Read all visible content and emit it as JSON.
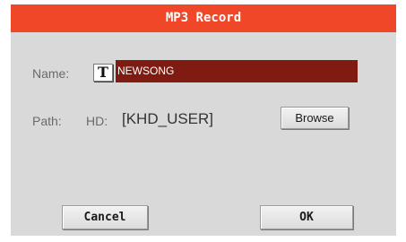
{
  "dialog": {
    "title": "MP3 Record",
    "title_color": "#ef4728",
    "background_color": "#d9d9d9"
  },
  "name_row": {
    "label": "Name:",
    "text_edit_icon": "T",
    "value": "NEWSONG",
    "field_color": "#7f1b10"
  },
  "path_row": {
    "label": "Path:",
    "drive": "HD:",
    "value": "[KHD_USER]",
    "browse_label": "Browse"
  },
  "buttons": {
    "cancel_label": "Cancel",
    "ok_label": "OK"
  }
}
